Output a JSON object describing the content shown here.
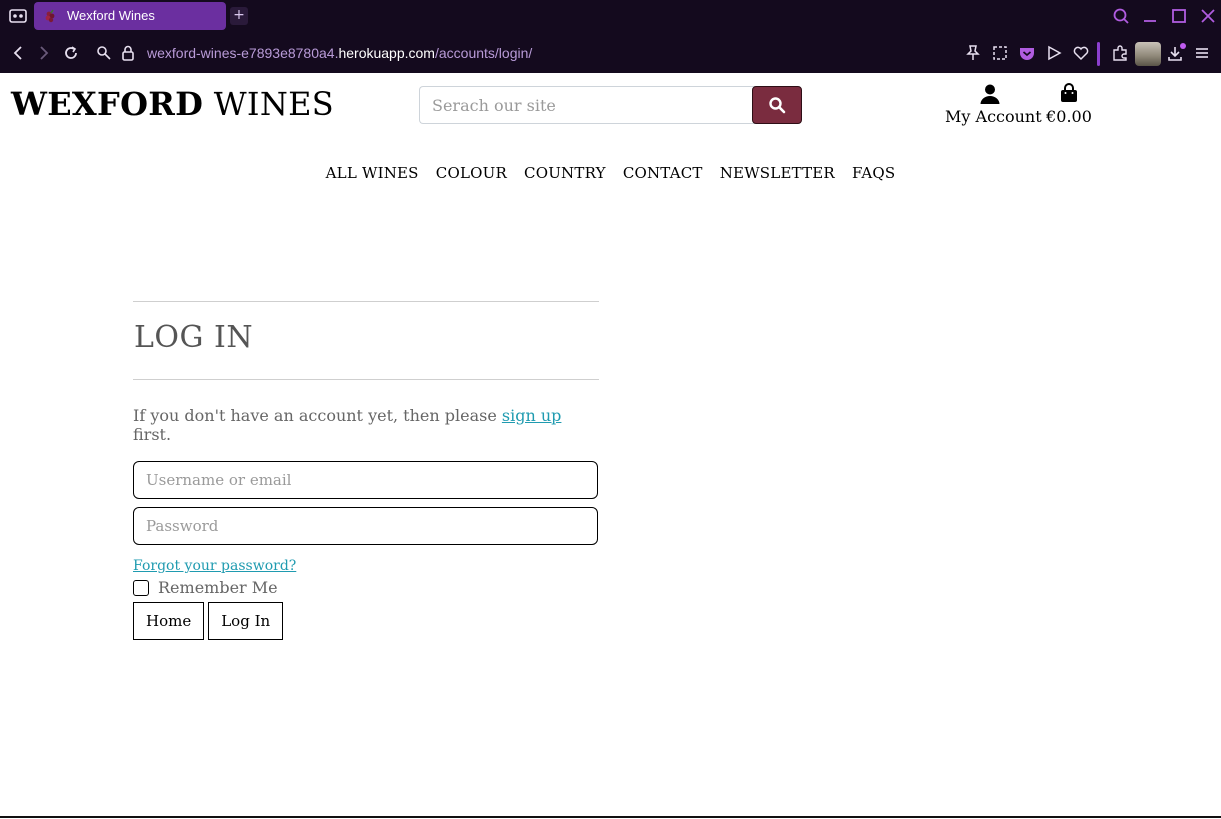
{
  "browser": {
    "tab_title": "Wexford Wines",
    "new_tab_label": "+",
    "url_prefix": "wexford-wines-e7893e8780a4.",
    "url_host": "herokuapp.com",
    "url_path": "/accounts/login/",
    "accent_color": "#6b2fa0"
  },
  "header": {
    "logo_bold": "WEXFORD",
    "logo_light": "WINES",
    "search_placeholder": "Serach our site",
    "account_label": "My Account",
    "bag_total": "€0.00",
    "search_button_color": "#7a2c3f"
  },
  "nav": {
    "items": [
      "ALL WINES",
      "COLOUR",
      "COUNTRY",
      "CONTACT",
      "NEWSLETTER",
      "FAQS"
    ]
  },
  "login": {
    "title": "LOG IN",
    "intro_before": "If you don't have an account yet, then please ",
    "intro_link": "sign up",
    "intro_after": " first.",
    "username_placeholder": "Username or email",
    "password_placeholder": "Password",
    "forgot_link": "Forgot your password?",
    "remember_label": "Remember Me",
    "home_button": "Home",
    "login_button": "Log In",
    "link_color": "#1f9bb0"
  }
}
